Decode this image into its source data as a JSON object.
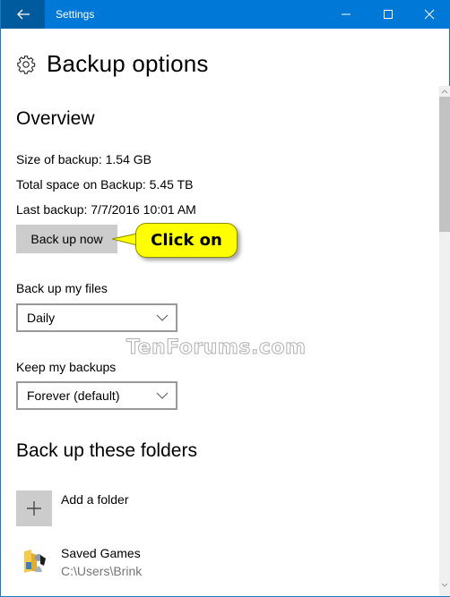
{
  "window": {
    "title": "Settings",
    "controls": {
      "minimize": "minimize-icon",
      "maximize": "maximize-icon",
      "close": "close-icon"
    },
    "back_icon": "arrow-left-icon",
    "accent_color": "#0078d7"
  },
  "page": {
    "icon": "gear-icon",
    "title": "Backup options"
  },
  "overview": {
    "heading": "Overview",
    "size_of_backup": "Size of backup: 1.54 GB",
    "total_space": "Total space on Backup: 5.45 TB",
    "last_backup": "Last backup: 7/7/2016 10:01 AM",
    "back_up_now_label": "Back up now"
  },
  "callout": {
    "text": "Click on",
    "color": "#ffff00"
  },
  "schedule": {
    "back_up_files_label": "Back up my files",
    "back_up_files_value": "Daily",
    "keep_backups_label": "Keep my backups",
    "keep_backups_value": "Forever (default)"
  },
  "watermark": "TenForums.com",
  "folders": {
    "heading": "Back up these folders",
    "add_label": "Add a folder",
    "items": [
      {
        "name": "Saved Games",
        "path": "C:\\Users\\Brink",
        "icon": "saved-games-folder-icon"
      }
    ]
  }
}
